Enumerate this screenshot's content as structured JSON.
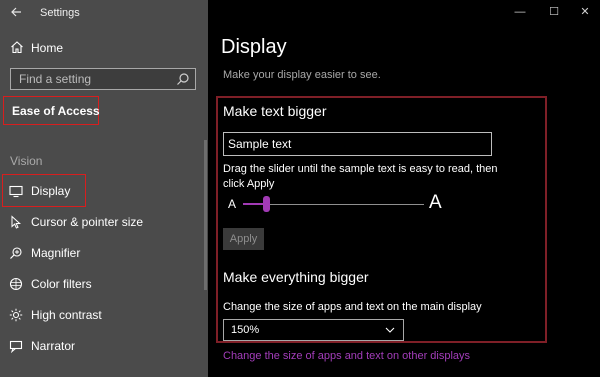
{
  "app": {
    "title": "Settings"
  },
  "window": {
    "minimize": "—",
    "maximize": "☐",
    "close": "✕"
  },
  "sidebar": {
    "home_label": "Home",
    "search_placeholder": "Find a setting",
    "category": "Ease of Access",
    "section": "Vision",
    "items": [
      {
        "label": "Display",
        "icon": "display-icon"
      },
      {
        "label": "Cursor & pointer size",
        "icon": "cursor-icon"
      },
      {
        "label": "Magnifier",
        "icon": "magnifier-icon"
      },
      {
        "label": "Color filters",
        "icon": "color-filters-icon"
      },
      {
        "label": "High contrast",
        "icon": "high-contrast-icon"
      },
      {
        "label": "Narrator",
        "icon": "narrator-icon"
      }
    ]
  },
  "main": {
    "title": "Display",
    "subtitle": "Make your display easier to see.",
    "text_bigger": {
      "heading": "Make text bigger",
      "sample_value": "Sample text",
      "instructions": "Drag the slider until the sample text is easy to read, then click Apply",
      "slider_min_glyph": "A",
      "slider_max_glyph": "A",
      "slider_value_fraction": 0.13,
      "apply_label": "Apply"
    },
    "everything_bigger": {
      "heading": "Make everything bigger",
      "description": "Change the size of apps and text on the main display",
      "selected": "150%"
    },
    "link": "Change the size of apps and text on other displays"
  },
  "colors": {
    "accent": "#a23ab5",
    "highlight_box": "#d81e1e",
    "section_box": "#7f1f27"
  }
}
